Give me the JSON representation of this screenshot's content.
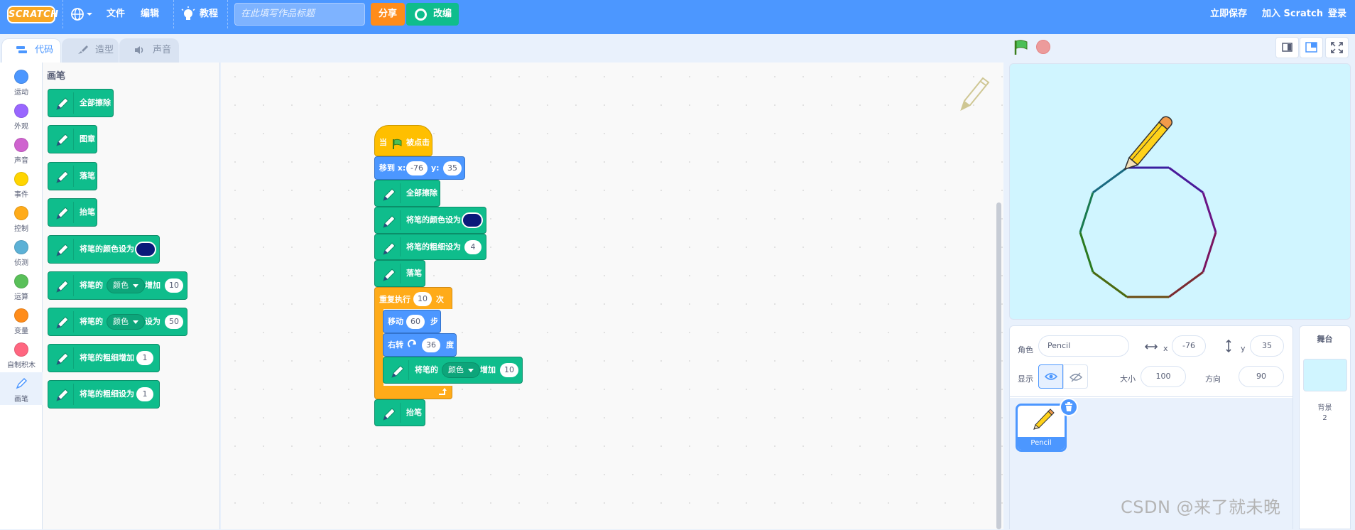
{
  "menubar": {
    "logo": "SCRATCH",
    "file": "文件",
    "edit": "编辑",
    "tutorials": "教程",
    "title_placeholder": "在此填写作品标题",
    "share": "分享",
    "remix": "改编",
    "save_now": "立即保存",
    "join": "加入 Scratch",
    "login": "登录"
  },
  "tabs": [
    "代码",
    "造型",
    "声音"
  ],
  "categories": [
    {
      "label": "运动",
      "color": "#4c97ff"
    },
    {
      "label": "外观",
      "color": "#9966ff"
    },
    {
      "label": "声音",
      "color": "#cf63cf"
    },
    {
      "label": "事件",
      "color": "#ffd500"
    },
    {
      "label": "控制",
      "color": "#ffab19"
    },
    {
      "label": "侦测",
      "color": "#5cb1d6"
    },
    {
      "label": "运算",
      "color": "#59c059"
    },
    {
      "label": "变量",
      "color": "#ff8c1a"
    },
    {
      "label": "自制积木",
      "color": "#ff6680"
    },
    {
      "label": "画笔",
      "color": "#0fbd8c"
    }
  ],
  "palette": {
    "heading": "画笔",
    "blocks": {
      "clear": "全部擦除",
      "stamp": "图章",
      "pen_down": "落笔",
      "pen_up": "抬笔",
      "set_color": "将笔的颜色设为",
      "change_param_a": "将笔的",
      "change_param_menu": "颜色",
      "change_param_b": "增加",
      "change_param_val": "10",
      "set_param_a": "将笔的",
      "set_param_menu": "颜色",
      "set_param_b": "设为",
      "set_param_val": "50",
      "change_size": "将笔的粗细增加",
      "change_size_val": "1",
      "set_size": "将笔的粗细设为",
      "set_size_val": "1"
    }
  },
  "script": {
    "hat_a": "当",
    "hat_b": "被点击",
    "goto_a": "移到 x:",
    "goto_x": "-76",
    "goto_b": "y:",
    "goto_y": "35",
    "clear": "全部擦除",
    "set_color": "将笔的颜色设为",
    "set_size": "将笔的粗细设为",
    "size_val": "4",
    "pen_down": "落笔",
    "repeat_a": "重复执行",
    "repeat_n": "10",
    "repeat_b": "次",
    "move_a": "移动",
    "move_n": "60",
    "move_b": "步",
    "turn_a": "右转",
    "turn_n": "36",
    "turn_b": "度",
    "change_a": "将笔的",
    "change_menu": "颜色",
    "change_b": "增加",
    "change_val": "10",
    "pen_up": "抬笔"
  },
  "sprite_info": {
    "sprite_label": "角色",
    "sprite_name": "Pencil",
    "x_label": "x",
    "x_val": "-76",
    "y_label": "y",
    "y_val": "35",
    "show_label": "显示",
    "size_label": "大小",
    "size_val": "100",
    "dir_label": "方向",
    "dir_val": "90",
    "thumb_name": "Pencil"
  },
  "stage_target": {
    "label": "舞台",
    "backdrops_label": "背景",
    "backdrops_count": "2"
  },
  "watermark": "CSDN @来了就未晚"
}
